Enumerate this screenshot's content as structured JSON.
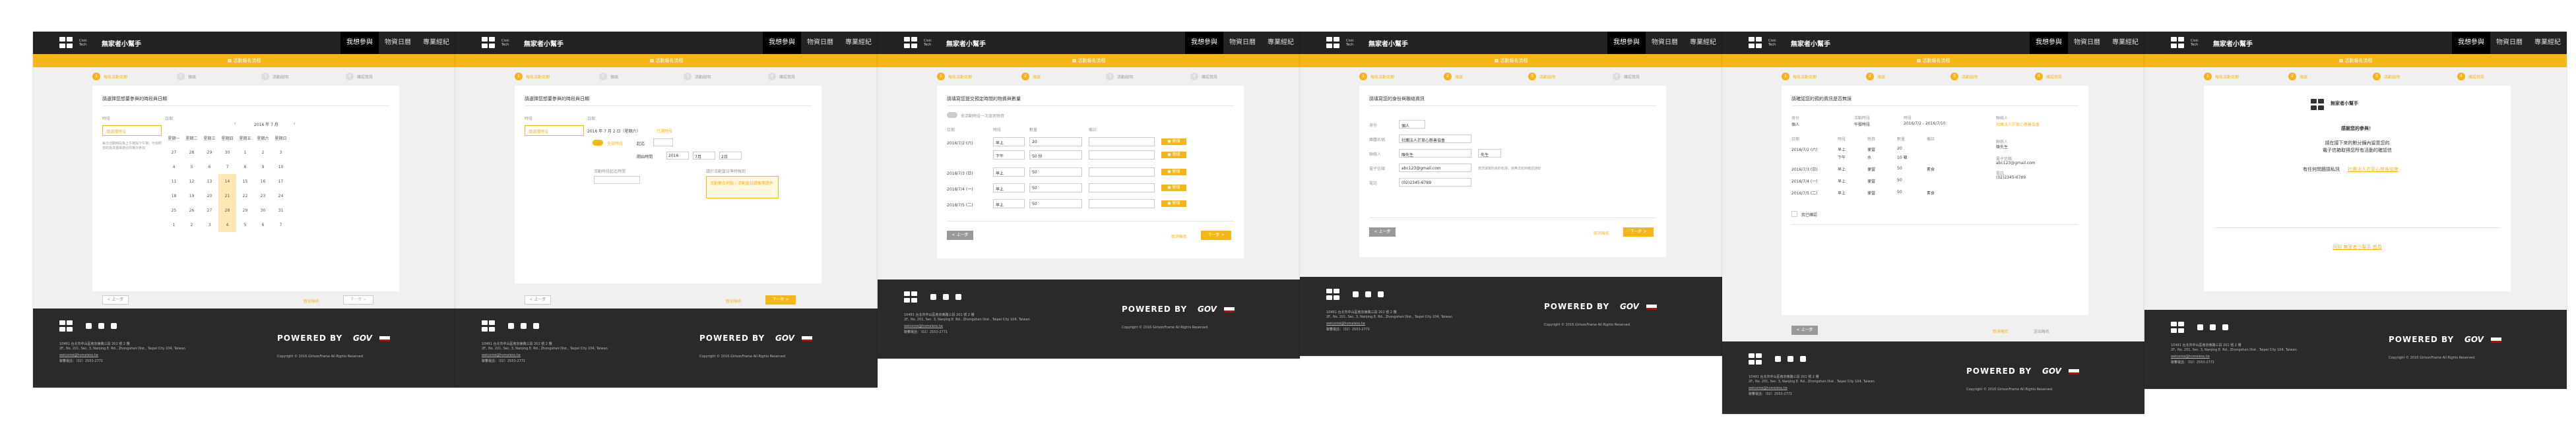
{
  "header": {
    "logo_text": "Civic Tech",
    "brand": "無家者小幫手",
    "nav": [
      "我想參與",
      "物資日曆",
      "專業經紀"
    ]
  },
  "banner": "▦ 活動報名流程",
  "steps": [
    "報名活動日期",
    "預填",
    "活動說明",
    "確認資訊"
  ],
  "screen1": {
    "prompt": "請選擇您想要參與的時段與日期",
    "col1": "時段",
    "col2": "日期",
    "slot_label": "請選擇時段",
    "slot_note": "每日活動時段為上午場與下午場，可依照您的需求選擇適合的場次參加",
    "month": "2016 年 7 月",
    "weekdays": [
      "星期一",
      "星期二",
      "星期三",
      "星期四",
      "星期五",
      "星期六",
      "星期日"
    ],
    "days": [
      "27",
      "28",
      "29",
      "30",
      "1",
      "2",
      "3",
      "4",
      "5",
      "6",
      "7",
      "8",
      "9",
      "10",
      "11",
      "12",
      "13",
      "14",
      "15",
      "16",
      "17",
      "18",
      "19",
      "20",
      "21",
      "22",
      "23",
      "24",
      "25",
      "26",
      "27",
      "28",
      "29",
      "30",
      "31",
      "1",
      "2",
      "3",
      "4",
      "5",
      "6",
      "7"
    ],
    "prev": "< 上一步",
    "next": "下一步 >",
    "link": "取消報名"
  },
  "screen2": {
    "prompt": "請選擇您想要參與的時段與日期",
    "col1": "時段",
    "col2": "日期",
    "date_line": "2016 年 7 月 2 日（星期六）",
    "date_tag": "已選時段",
    "toggle_label": "全部時段",
    "f1": "起迄",
    "f2": "開始時間",
    "f3": "結束時間",
    "f4": "活動時段起迄時間",
    "f5": "請於活動當日準時報到",
    "v_from": "2016",
    "v_m": "7月",
    "v_d": "2日",
    "hint": "活動集合地點 / 活動當日請攜帶證件",
    "prev": "< 上一步",
    "next": "下一步 >",
    "link": "取消報名"
  },
  "screen3": {
    "prompt": "請填寫您提交預定時間的物資與數量",
    "toggle": "依活動時段一次填寫物資",
    "cols": [
      "日期",
      "時段",
      "數量",
      "備註"
    ],
    "rows": [
      {
        "date": "2016/7/2 (六)",
        "slot": "早上",
        "qty": "20",
        "note": ""
      },
      {
        "date": "",
        "slot": "下午",
        "qty": "50 份",
        "note": ""
      },
      {
        "date": "2016/7/3 (日)",
        "slot": "早上",
        "qty": "50",
        "note": ""
      },
      {
        "date": "2016/7/4 (一)",
        "slot": "早上",
        "qty": "50",
        "note": ""
      },
      {
        "date": "2016/7/5 (二)",
        "slot": "早上",
        "qty": "50",
        "note": ""
      }
    ],
    "row_btn": "● 新增",
    "prev": "< 上一步",
    "next": "下一步 >",
    "link": "取消報名"
  },
  "screen4": {
    "prompt": "請填寫您的身份與聯絡資訊",
    "fields": [
      {
        "label": "身份",
        "value": "個人"
      },
      {
        "label": "團體名稱",
        "value": "社團法人芒草心慈善協會"
      },
      {
        "label": "聯絡人",
        "value": "陳先生"
      },
      {
        "label": "電子信箱",
        "value": "abc123@gmail.com"
      },
      {
        "label": "電話",
        "value": "(02)2345-6789"
      }
    ],
    "gender": "先生",
    "note": "若您填寫的資料有誤，將無法收到確認通知",
    "prev": "< 上一步",
    "next": "下一步 >",
    "link": "取消報名"
  },
  "screen5": {
    "prompt": "請確認您的預約資訊是否無誤",
    "h1": "身份",
    "h2": "活動時段",
    "h3": "時段",
    "h4": "聯絡人",
    "v1": "個人",
    "v2": "午餐時段",
    "v3": "2016/7/2 - 2016/7/10",
    "v4": "社團法人芒草心慈善協會",
    "contact": [
      "聯絡人",
      "陳先生",
      "電子信箱",
      "abc123@gmail.com",
      "電話",
      "(02)2345-6789"
    ],
    "cols": [
      "日期",
      "時段",
      "物資",
      "數量",
      "備註"
    ],
    "rows": [
      {
        "date": "2016/7/2 (六)",
        "slot": "早上",
        "item": "便當",
        "qty": "20",
        "note": ""
      },
      {
        "date": "",
        "slot": "下午",
        "item": "水",
        "qty": "10 箱",
        "note": ""
      },
      {
        "date": "2016/7/3 (日)",
        "slot": "早上",
        "item": "便當",
        "qty": "50",
        "note": "素食"
      },
      {
        "date": "2016/7/4 (一)",
        "slot": "早上",
        "item": "便當",
        "qty": "50",
        "note": ""
      },
      {
        "date": "2016/7/5 (二)",
        "slot": "早上",
        "item": "便當",
        "qty": "50",
        "note": "素食"
      }
    ],
    "agree": "我已確認",
    "prev": "< 上一步",
    "link": "取消報名",
    "submit": "送出報名"
  },
  "screen6": {
    "logo_text": "Civic Tech",
    "brand": "無家者小幫手",
    "thanks": "感謝您的參與！",
    "msg1": "請在接下來的數分鐘內留意您的",
    "msg2": "電子信箱取得您所有活動的確認信",
    "msg3": "有任何問題請私訊",
    "msg3_link": "社團法人芒草心慈善協會",
    "back": "回到 無家者小幫手 首頁"
  },
  "footer": {
    "addr1": "10491 台北市中山區南京東路三段 201 號 2 樓",
    "addr2": "2F., No. 201, Sec. 3, Nanjing E. Rd., Zhongshan Dist., Taipei City 104, Taiwan",
    "email": "welcome@homeless.tw",
    "phone": "聯繫電話：（02）2553-2771",
    "powered": "POWERED BY",
    "gov": "GOV",
    "copyright": "Copyright © 2016 GirlsonFrame All Rights Reserved."
  },
  "colors": {
    "accent": "#f6b519",
    "dark": "#222222",
    "footer": "#2a2a2a"
  }
}
